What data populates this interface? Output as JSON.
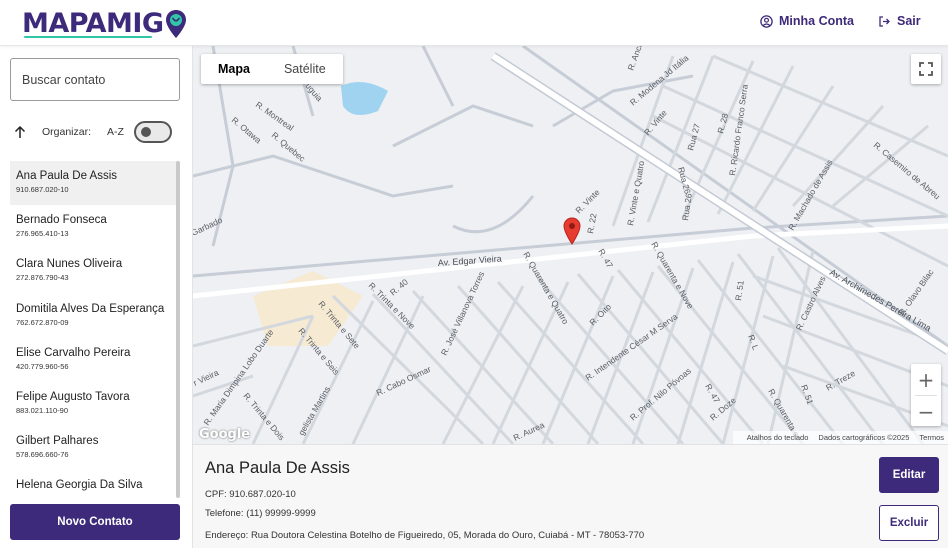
{
  "header": {
    "logo_text": "MAPAMIG",
    "account_label": "Minha Conta",
    "logout_label": "Sair",
    "accent_color": "#3d2a7a",
    "logo_accent_color": "#2fc7a8"
  },
  "sidebar": {
    "search_placeholder": "Buscar contato",
    "sort_label": "Organizar:",
    "sort_order": "A-Z",
    "contacts": [
      {
        "name": "Ana Paula De Assis",
        "cpf": "910.687.020-10",
        "selected": true
      },
      {
        "name": "Bernado Fonseca",
        "cpf": "276.965.410-13"
      },
      {
        "name": "Clara Nunes Oliveira",
        "cpf": "272.876.790-43"
      },
      {
        "name": "Domitila Alves Da Esperança",
        "cpf": "762.672.870-09"
      },
      {
        "name": "Elise Carvalho Pereira",
        "cpf": "420.779.960-56"
      },
      {
        "name": "Felipe Augusto Tavora",
        "cpf": "883.021.110-90"
      },
      {
        "name": "Gilbert Palhares",
        "cpf": "578.696.660-76"
      },
      {
        "name": "Helena Georgia Da Silva",
        "cpf": ""
      }
    ],
    "new_contact_label": "Novo Contato"
  },
  "map": {
    "tab_map": "Mapa",
    "tab_satellite": "Satélite",
    "zoom_in": "+",
    "zoom_out": "−",
    "google_label": "Google",
    "footer_shortcuts": "Atalhos do teclado",
    "footer_data": "Dados cartográficos ©2025",
    "footer_terms": "Termos",
    "streets": {
      "edgar_vieira": "Av. Edgar Vieira",
      "archimedes": "Av. Archimedes Pereira Lima",
      "vinte": "R. Vinte",
      "vinte_quatro": "R. Vinte e Quatro",
      "r22": "R. 22",
      "r47": "R. 47",
      "r40": "R. 40",
      "trinta_nove": "R. Trinta e Nove",
      "trinta_sete": "R. Trinta e Sete",
      "trinta_seis": "R. Trinta e Seis",
      "trinta_dois": "R. Trinta e Dois",
      "quarenta_quatro": "R. Quarenta e Quatro",
      "quarenta_nove": "R. Quarenta e Nove",
      "oito": "R. Oito",
      "jose_villanova": "R. José Villanova Torres",
      "cesar_serva": "R. Intendente César M Serva",
      "nilo_povoas": "R. Prof. Nilo Póvoas",
      "doze": "R. Doze",
      "cabo_osmar": "R. Cabo Osmar",
      "lobo_duarte": "R. Maria Dimpina Lobo Duarte",
      "machado_assis": "R. Machado de Assis",
      "casemiro": "R. Casemiro de Abreu",
      "ricardo_serra": "R. Ricardo Franco Serra",
      "r28": "R. 28",
      "rua27": "Rua 27",
      "rua26": "Rua 26",
      "rua26b": "Rua 26",
      "r51": "R. 51",
      "r51b": "R. 51",
      "treze": "R. Treze",
      "castro_alves": "R. Castro Alves",
      "olavo_bilac": "R. Olavo Bilac",
      "montreal": "R. Montreal",
      "quebec": "R. Quebec",
      "otawa": "R. Otawa",
      "modena": "R. Modena Jd Itália",
      "ancona": "R. Ancona",
      "vinte_top": "R. Vinte",
      "quarenta_sete": "R. 47",
      "arcelina": "R. L",
      "martins": "gelista Martins",
      "vieira": "r Vieira",
      "aurea": "R. Aurea",
      "garbado": "Garbado",
      "quarenta_e_s": "R. Quarenta e S",
      "x47": "R. 47",
      "ruto": "R. Quarenta e",
      "uguia": "uguia"
    }
  },
  "details": {
    "name": "Ana Paula De Assis",
    "cpf_line": "CPF: 910.687.020-10",
    "phone_line": "Telefone: (11) 99999-9999",
    "address_line": "Endereço: Rua Doutora Celestina Botelho de Figueiredo, 05, Morada do Ouro, Cuiabá - MT - 78053-770",
    "edit_label": "Editar",
    "delete_label": "Excluir"
  }
}
